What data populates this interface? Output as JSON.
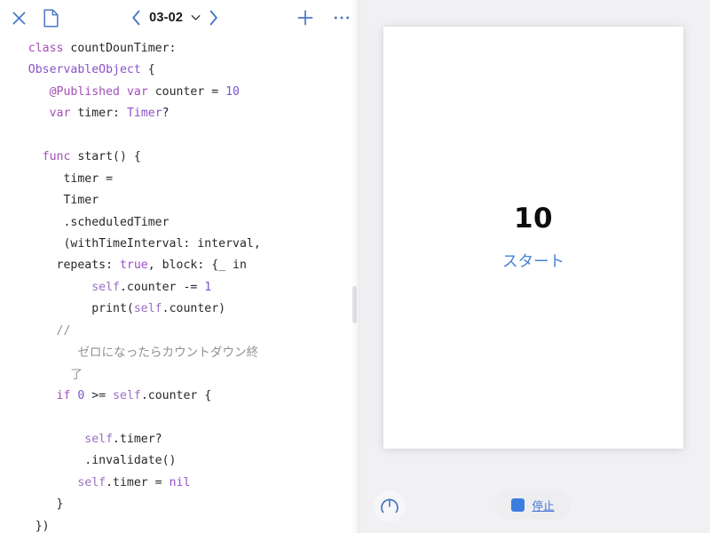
{
  "window": {
    "app_kind": "swift-playgrounds-editor",
    "accent_color": "#4a77c4",
    "editor_bg": "#ffffff",
    "preview_bg": "#f1f1f4"
  },
  "toolbar": {
    "close_icon": "close-x-icon",
    "document_icon": "document-page-icon",
    "prev_icon": "chevron-left-icon",
    "next_icon": "chevron-right-icon",
    "page_menu_icon": "chevron-down-icon",
    "page_label": "03-02",
    "add_icon": "plus-icon",
    "more_icon": "ellipsis-icon"
  },
  "editor": {
    "language": "swift",
    "code_lines": [
      "class countDounTimer:",
      " ObservableObject {",
      "    @Published var counter = 10",
      "    var timer: Timer?",
      "",
      "    func start() {",
      "        timer =",
      "        Timer",
      "        .scheduledTimer",
      "        (withTimeInterval: interval,",
      "        repeats: true, block: {_ in",
      "            self.counter -= 1",
      "            print(self.counter)",
      "        //",
      "          ゼロになったらカウントダウン終",
      "          了",
      "        if 0 >= self.counter {",
      "",
      "            self.timer?",
      "            .invalidate()",
      "            self.timer = nil",
      "        }",
      "    })"
    ],
    "scrollbar": "vertical-scrollbar-thumb"
  },
  "preview": {
    "counter_value": "10",
    "start_label": "スタート",
    "start_color": "#4a82d8",
    "gauge_icon": "speedometer-icon",
    "stop_icon": "stop-square-icon",
    "stop_label": "停止",
    "stop_color": "#3f73cf"
  }
}
